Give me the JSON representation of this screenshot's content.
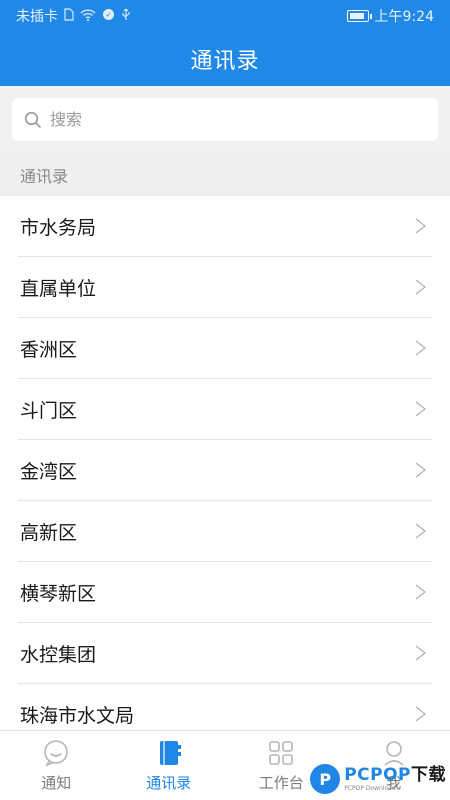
{
  "status_bar": {
    "carrier": "未插卡",
    "time": "上午9:24",
    "battery_level": 0.9
  },
  "header": {
    "title": "通讯录"
  },
  "search": {
    "placeholder": "搜索"
  },
  "section": {
    "title": "通讯录"
  },
  "contacts": [
    {
      "label": "市水务局"
    },
    {
      "label": "直属单位"
    },
    {
      "label": "香洲区"
    },
    {
      "label": "斗门区"
    },
    {
      "label": "金湾区"
    },
    {
      "label": "高新区"
    },
    {
      "label": "横琴新区"
    },
    {
      "label": "水控集团"
    },
    {
      "label": "珠海市水文局"
    }
  ],
  "tabs": [
    {
      "label": "通知",
      "icon": "chat-bubble-icon",
      "active": false
    },
    {
      "label": "通讯录",
      "icon": "address-book-icon",
      "active": true
    },
    {
      "label": "工作台",
      "icon": "grid-apps-icon",
      "active": false
    },
    {
      "label": "我",
      "icon": "person-icon",
      "active": false
    }
  ],
  "watermark": {
    "brand": "PCPOP",
    "suffix": "下载",
    "sub": "PCPOP Download"
  },
  "colors": {
    "primary": "#2088e6",
    "active_tab": "#1f86e5",
    "inactive_tab": "#7c7c7c",
    "chevron": "#b5b5b5"
  }
}
